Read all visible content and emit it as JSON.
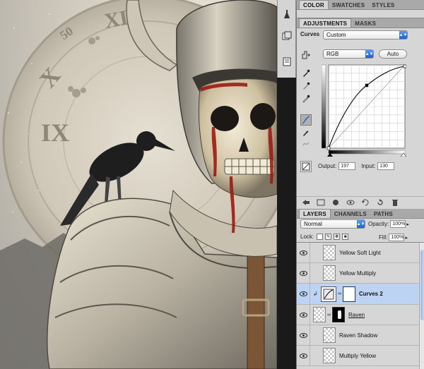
{
  "top_tabs": [
    "COLOR",
    "SWATCHES",
    "STYLES"
  ],
  "adjust_tabs": [
    "ADJUSTMENTS",
    "MASKS"
  ],
  "curves": {
    "title": "Curves",
    "preset": "Custom",
    "channel": "RGB",
    "auto_label": "Auto",
    "output_label": "Output:",
    "output_value": "197",
    "input_label": "Input:",
    "input_value": "130"
  },
  "layers_tabs": [
    "LAYERS",
    "CHANNELS",
    "PATHS"
  ],
  "layers_controls": {
    "blend_mode": "Normal",
    "opacity_label": "Opacity:",
    "opacity_value": "100%",
    "lock_label": "Lock:",
    "fill_label": "Fill:",
    "fill_value": "100%"
  },
  "layers": [
    {
      "name": "Yellow Soft Light"
    },
    {
      "name": "Yellow Multiply"
    },
    {
      "name": "Curves 2"
    },
    {
      "name": "Raven"
    },
    {
      "name": "Raven Shadow"
    },
    {
      "name": "Multiply Yellow"
    }
  ],
  "clock_numerals": [
    "XII",
    "X",
    "IX",
    "50"
  ],
  "colors": {
    "selection": "#bcd3f3",
    "panel_bg": "#d6d6d6",
    "accent_blue": "#1f5fcf",
    "blood": "#9b1b12"
  }
}
